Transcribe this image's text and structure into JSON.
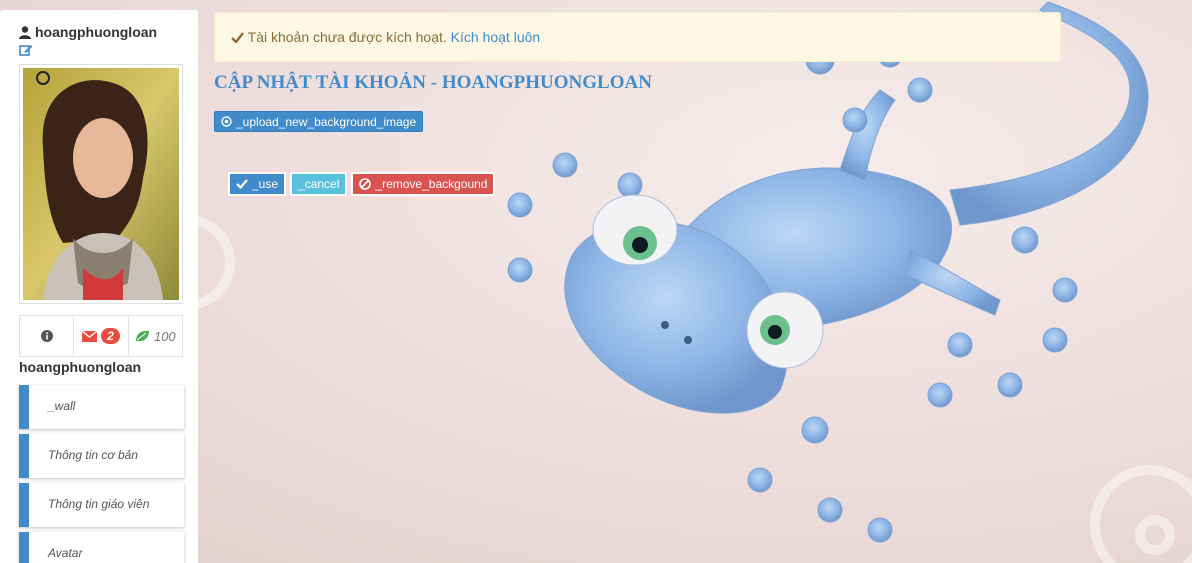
{
  "sidebar": {
    "title": "hoangphuongloan",
    "stats": {
      "unread_messages": "2",
      "points": "100"
    },
    "username": "hoangphuongloan",
    "nav_items": [
      {
        "label": "_wall"
      },
      {
        "label": "Thông tin cơ bản"
      },
      {
        "label": "Thông tin giáo viên"
      },
      {
        "label": "Avatar"
      }
    ]
  },
  "alert": {
    "message": "Tài khoản chưa được kích hoạt.",
    "link": "Kích hoạt luôn"
  },
  "main": {
    "title": "CẬP NHẬT TÀI KHOẢN - HOANGPHUONGLOAN",
    "upload_button": "_upload_new_background_image",
    "use_button": "_use",
    "cancel_button": "_cancel",
    "remove_button": "_remove_backgound"
  },
  "colors": {
    "primary": "#428bca",
    "info": "#5bc0de",
    "danger": "#d9534f",
    "alert_bg": "#fcf8e3",
    "alert_text": "#8a6d3b"
  }
}
